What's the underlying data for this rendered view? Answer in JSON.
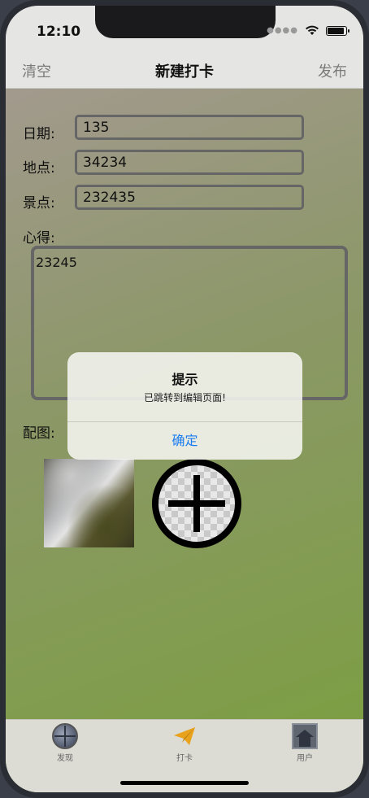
{
  "status": {
    "time": "12:10"
  },
  "nav": {
    "left": "清空",
    "title": "新建打卡",
    "right": "发布"
  },
  "form": {
    "date_label": "日期:",
    "date_value": "135",
    "place_label": "地点:",
    "place_value": "34234",
    "scenic_label": "景点:",
    "scenic_value": "232435",
    "notes_label": "心得:",
    "notes_value": "23245",
    "images_label": "配图:"
  },
  "alert": {
    "title": "提示",
    "message": "已跳转到编辑页面!",
    "confirm": "确定"
  },
  "tabs": [
    {
      "label": "发现",
      "icon": "globe-icon"
    },
    {
      "label": "打卡",
      "icon": "paper-plane-icon"
    },
    {
      "label": "用户",
      "icon": "house-icon"
    }
  ],
  "colors": {
    "accent": "#1a7cf0",
    "plane": "#e8a21c"
  }
}
